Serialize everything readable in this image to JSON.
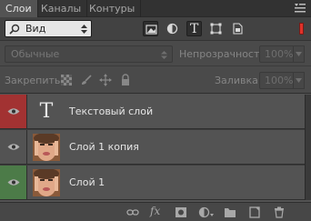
{
  "tabs": [
    {
      "label": "Слои",
      "active": true
    },
    {
      "label": "Каналы",
      "active": false
    },
    {
      "label": "Контуры",
      "active": false
    }
  ],
  "filter": {
    "kind_value": "Вид",
    "filter_icons": [
      "image-filter-icon",
      "adjustment-filter-icon",
      "text-filter-icon",
      "shape-filter-icon",
      "smart-object-filter-icon"
    ],
    "text_filter_glyph": "T",
    "toggle_color": "#e0322a"
  },
  "blend": {
    "mode": "Обычные",
    "opacity_label": "Непрозрачность:",
    "opacity_value": "100%"
  },
  "lock": {
    "label": "Закрепить:",
    "fill_label": "Заливка:",
    "fill_value": "100%"
  },
  "layers": [
    {
      "name": "Текстовый слой",
      "type": "text",
      "thumb_glyph": "T",
      "eye_bg": "#a23232"
    },
    {
      "name": "Слой 1 копия",
      "type": "image",
      "eye_bg": "#535353"
    },
    {
      "name": "Слой 1",
      "type": "image",
      "eye_bg": "#4c7b48"
    }
  ],
  "bottom_icons": [
    "link-layers-icon",
    "layer-style-icon",
    "layer-mask-icon",
    "adjustment-layer-icon",
    "new-group-icon",
    "new-layer-icon",
    "delete-layer-icon"
  ],
  "bottom_fx_label": "fx"
}
